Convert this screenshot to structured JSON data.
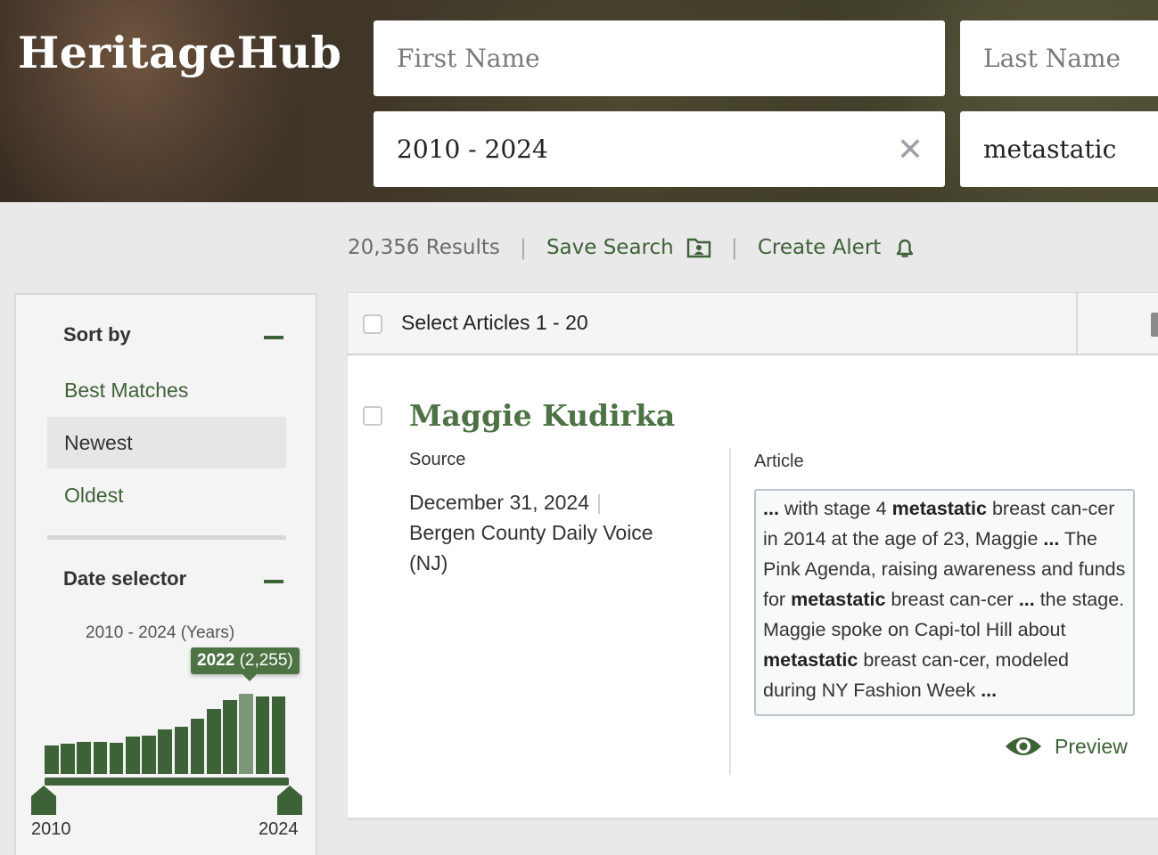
{
  "app": {
    "logo": "HeritageHub"
  },
  "search": {
    "first_name_placeholder": "First Name",
    "last_name_placeholder": "Last Name",
    "date_range_value": "2010 - 2024",
    "keyword_value": "metastatic"
  },
  "results": {
    "count_text": "20,356 Results",
    "separator": "|",
    "save_search_label": "Save Search",
    "create_alert_label": "Create Alert"
  },
  "sidebar": {
    "sort_heading": "Sort by",
    "sort_options": [
      "Best Matches",
      "Newest",
      "Oldest"
    ],
    "selected_sort": "Newest",
    "date_heading": "Date selector",
    "date_range_label": "2010 - 2024 (Years)",
    "tooltip_year": "2022",
    "tooltip_count": "(2,255)",
    "start_year": "2010",
    "end_year": "2024",
    "highlighted_year": 2022
  },
  "chart_data": {
    "type": "bar",
    "categories": [
      "2010",
      "2011",
      "2012",
      "2013",
      "2014",
      "2015",
      "2016",
      "2017",
      "2018",
      "2019",
      "2020",
      "2021",
      "2022",
      "2023",
      "2024"
    ],
    "values": [
      805,
      855,
      905,
      905,
      880,
      1055,
      1080,
      1250,
      1330,
      1545,
      1820,
      2075,
      2255,
      2190,
      2190
    ]
  },
  "list": {
    "select_label": "Select Articles 1 - 20"
  },
  "article": {
    "title": "Maggie Kudirka",
    "source_label": "Source",
    "date": "December 31, 2024",
    "date_pipe": "|",
    "publication": "Bergen County Daily Voice (NJ)",
    "article_label": "Article",
    "snippet_parts": [
      {
        "t": "... ",
        "b": true
      },
      {
        "t": "with stage 4 ",
        "b": false
      },
      {
        "t": "metastatic",
        "b": true
      },
      {
        "t": " breast can-cer in 2014 at the age of 23, Maggie ",
        "b": false
      },
      {
        "t": "...",
        "b": true
      },
      {
        "t": " The Pink Agenda, raising awareness and funds for ",
        "b": false
      },
      {
        "t": "metastatic",
        "b": true
      },
      {
        "t": " breast can-cer ",
        "b": false
      },
      {
        "t": "...",
        "b": true
      },
      {
        "t": " the stage. Maggie spoke on Capi-tol Hill about ",
        "b": false
      },
      {
        "t": "metastatic",
        "b": true
      },
      {
        "t": " breast can-cer, modeled during NY Fashion Week ",
        "b": false
      },
      {
        "t": "...",
        "b": true
      }
    ],
    "preview_label": "Preview"
  },
  "colors": {
    "brand_green": "#3e6237",
    "highlight_bar": "#7c967a",
    "tooltip_bg": "#4d7345"
  }
}
